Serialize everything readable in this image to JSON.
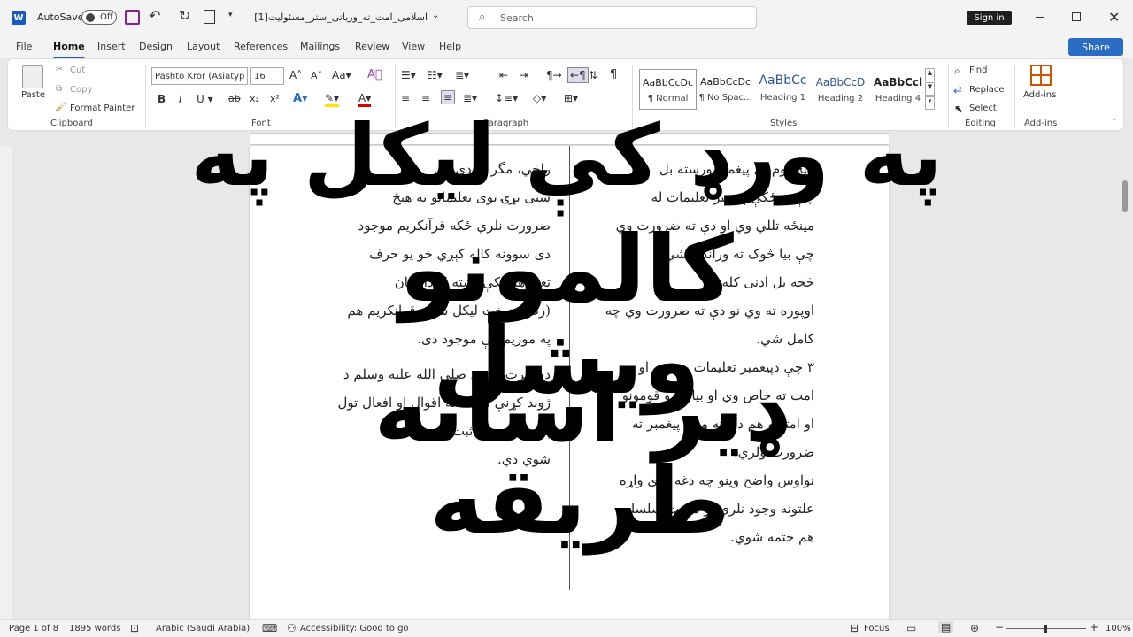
{
  "titlebar": {
    "autosave_label": "AutoSave",
    "autosave_state": "Off",
    "doc_title": "اسلامی_امت_ته_وریاتی_ستر_مسئولیت[1]...",
    "search_placeholder": "Search",
    "signin": "Sign in"
  },
  "tabs": [
    "File",
    "Home",
    "Insert",
    "Design",
    "Layout",
    "References",
    "Mailings",
    "Review",
    "View",
    "Help"
  ],
  "share": "Share",
  "ribbon": {
    "clipboard": {
      "paste": "Paste",
      "cut": "Cut",
      "copy": "Copy",
      "format_painter": "Format Painter",
      "group": "Clipboard"
    },
    "font": {
      "name": "Pashto Kror (Asiatyp",
      "size": "16",
      "group": "Font"
    },
    "paragraph": {
      "group": "Paragraph"
    },
    "styles": {
      "group": "Styles",
      "items": [
        {
          "sample": "AaBbCcDc",
          "name": "¶ Normal"
        },
        {
          "sample": "AaBbCcDc",
          "name": "¶ No Spac..."
        },
        {
          "sample": "AaBbCc",
          "name": "Heading 1"
        },
        {
          "sample": "AaBbCcD",
          "name": "Heading 2"
        },
        {
          "sample": "AaBbCcl",
          "name": "Heading 4"
        }
      ]
    },
    "editing": {
      "find": "Find",
      "replace": "Replace",
      "select": "Select",
      "group": "Editing"
    },
    "addins": {
      "label": "Add-ins",
      "group": "Add-ins"
    }
  },
  "document": {
    "left_col": [
      "راخي، مگر په دې كې",
      "سنی نړۍ نوی تعلیماتو ته هیڅ",
      "ضرورت نلري ځکه قرآنکریم موجود",
      "دی سوونه کاله کېږي خو یو حرف",
      "تغیر هم پکې نشته او دا شان",
      "(رض) د خت لیکل شوی قرانکریم هم",
      "په موزیم کې موجود دی.",
      "دحضرت محمد صلی الله علیه وسلم د",
      "ژوند کړنې او د هغه اقوال او افعال تول",
      "په مکمل ډول ثبت کې ساتل",
      "شوي دي."
    ],
    "right_col": [
      "هیڅ نوم بل پیغمبر ورسته بل",
      "چې دمځکې پیغمبر تعلیمات له",
      "مینځه تللي وي او دې ته ضرورت وي",
      "چې بیا څوک ته وراندې شي.",
      "څخه بل ادنی کله",
      "اوپوره ته وي نو دې ته ضرورت وي چه",
      "کامل شي.",
      "۳ چې دپیغمبر تعلیمات یو قوم او",
      "امت ته خاص وي او بیا نورو قومونو",
      "او امتونو هم دی ته ورته پیغمبر ته",
      "ضرورت ولري.",
      "نواوس واضح وینو چه دغه دری واړه",
      "علتونه وجود نلري نو دنبوت سلسله",
      "هم ختمه شوي."
    ]
  },
  "overlay": {
    "line1": "په ورډ کې لیکل په",
    "line2": "کالمونو ویشل",
    "line3": "ډیر اسانه طریقه"
  },
  "status": {
    "page": "Page 1 of 8",
    "words": "1895 words",
    "language": "Arabic (Saudi Arabia)",
    "accessibility": "Accessibility: Good to go",
    "focus": "Focus",
    "zoom": "100%"
  }
}
